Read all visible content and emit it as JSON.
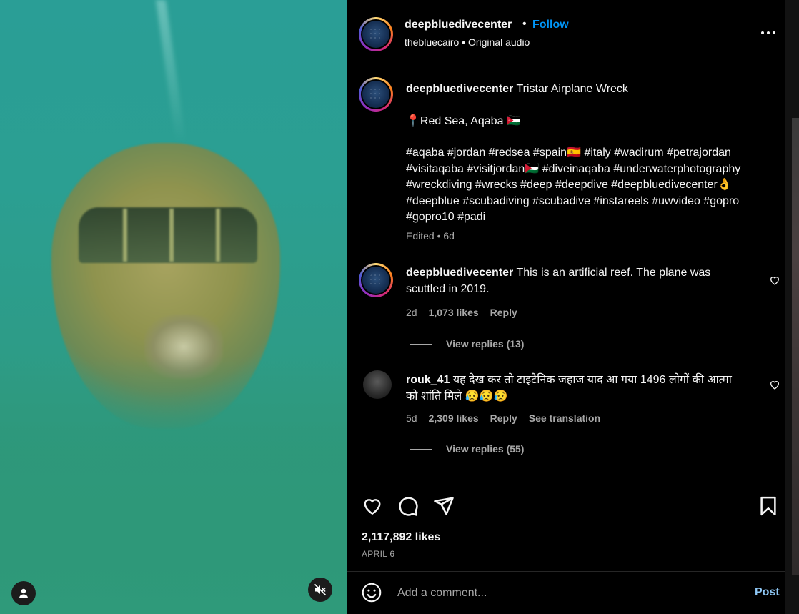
{
  "post": {
    "username": "deepbluedivecenter",
    "follow_label": "Follow",
    "separator": "•",
    "audio_line": "thebluecairo • Original audio"
  },
  "caption": {
    "username": "deepbluedivecenter",
    "title": "Tristar Airplane Wreck",
    "location": "📍Red Sea, Aqaba 🇯🇴",
    "hashtags": "#aqaba #jordan #redsea #spain🇪🇸 #italy #wadirum #petrajordan #visitaqaba #visitjordan🇯🇴 #diveinaqaba #underwaterphotography #wreckdiving #wrecks #deep #deepdive #deepbluedivecenter👌 #deepblue #scubadiving #scubadive #instareels #uwvideo #gopro #gopro10 #padi",
    "edited": "Edited • 6d"
  },
  "comments": [
    {
      "username": "deepbluedivecenter",
      "text": "This is an artificial reef. The plane was scuttled in 2019.",
      "age": "2d",
      "likes": "1,073 likes",
      "reply_label": "Reply",
      "view_replies": "View replies (13)"
    },
    {
      "username": "rouk_41",
      "text": "यह देख कर तो टाइटैनिक जहाज याद आ गया 1496 लोगों की आत्मा को शांति मिले 😥😥😥",
      "age": "5d",
      "likes": "2,309 likes",
      "reply_label": "Reply",
      "translation_label": "See translation",
      "view_replies": "View replies (55)"
    }
  ],
  "stats": {
    "likes": "2,117,892 likes",
    "date": "APRIL 6"
  },
  "composer": {
    "placeholder": "Add a comment...",
    "post_label": "Post"
  },
  "icons": {
    "more": "more-options-icon",
    "like": "heart-icon",
    "comment": "comment-icon",
    "share": "share-icon",
    "save": "bookmark-icon",
    "emoji": "emoji-icon",
    "mute": "muted-speaker-icon",
    "user": "user-icon"
  },
  "colors": {
    "accent": "#0095f6",
    "post_button": "#8ec7f5",
    "muted_text": "#a8a8a8"
  }
}
